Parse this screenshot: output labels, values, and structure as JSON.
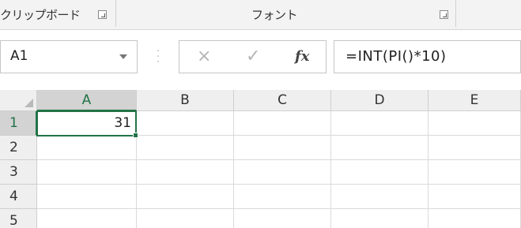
{
  "ribbon": {
    "clipboard_label": "クリップボード",
    "font_label": "フォント"
  },
  "formula_bar": {
    "name_box": "A1",
    "cancel_symbol": "×",
    "enter_symbol": "✓",
    "fx_symbol": "fx",
    "formula": "=INT(PI()*10)"
  },
  "grid": {
    "columns": [
      "A",
      "B",
      "C",
      "D",
      "E"
    ],
    "rows": [
      "1",
      "2",
      "3",
      "4",
      "5"
    ],
    "cells": {
      "A1": "31"
    },
    "selected_cell": "A1"
  },
  "colors": {
    "excel_green": "#217346",
    "header_bg": "#efefef",
    "active_header_bg": "#d3d3d3"
  }
}
